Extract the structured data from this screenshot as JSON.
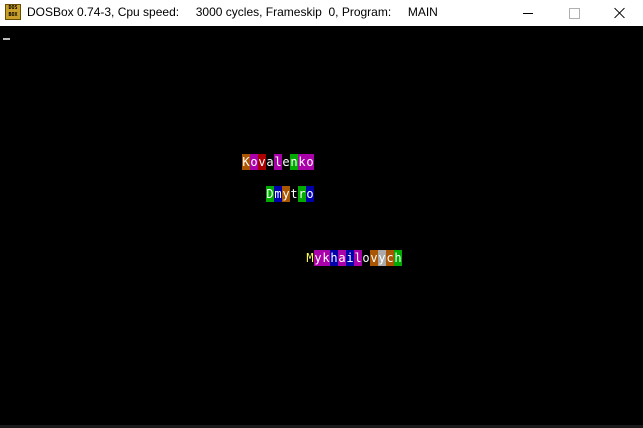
{
  "window": {
    "title": "DOSBox 0.74-3, Cpu speed:     3000 cycles, Frameskip  0, Program:     MAIN",
    "icon": "dosbox-icon",
    "icon_text": "DOS BOX"
  },
  "screen": {
    "rows": [
      {
        "name": "surname",
        "text": "Kovalenko",
        "cells": [
          {
            "ch": "K",
            "fg": "#ffffff",
            "bg": "#aa5500"
          },
          {
            "ch": "o",
            "fg": "#ffffff",
            "bg": "#aa00aa"
          },
          {
            "ch": "v",
            "fg": "#ffffff",
            "bg": "#aa0000"
          },
          {
            "ch": "a",
            "fg": "#ffffff",
            "bg": "#000000"
          },
          {
            "ch": "l",
            "fg": "#ffffff",
            "bg": "#aa00aa"
          },
          {
            "ch": "e",
            "fg": "#ffffff",
            "bg": "#000000"
          },
          {
            "ch": "n",
            "fg": "#ffffff",
            "bg": "#00aa00"
          },
          {
            "ch": "k",
            "fg": "#ffffff",
            "bg": "#aa00aa"
          },
          {
            "ch": "o",
            "fg": "#ffffff",
            "bg": "#aa00aa"
          }
        ]
      },
      {
        "name": "first-name",
        "text": "Dmytro",
        "cells": [
          {
            "ch": "D",
            "fg": "#ffffff",
            "bg": "#00aa00"
          },
          {
            "ch": "m",
            "fg": "#ffffff",
            "bg": "#0000aa"
          },
          {
            "ch": "y",
            "fg": "#ffffff",
            "bg": "#aa5500"
          },
          {
            "ch": "t",
            "fg": "#ffffff",
            "bg": "#000000"
          },
          {
            "ch": "r",
            "fg": "#ffffff",
            "bg": "#00aa00"
          },
          {
            "ch": "o",
            "fg": "#ffffff",
            "bg": "#0000aa"
          }
        ]
      },
      {
        "name": "patronymic",
        "text": "Mykhailovych",
        "cells": [
          {
            "ch": "M",
            "fg": "#ffff55",
            "bg": "#000000"
          },
          {
            "ch": "y",
            "fg": "#ffffff",
            "bg": "#aa00aa"
          },
          {
            "ch": "k",
            "fg": "#ffffff",
            "bg": "#aa00aa"
          },
          {
            "ch": "h",
            "fg": "#ffffff",
            "bg": "#0000aa"
          },
          {
            "ch": "a",
            "fg": "#ffffff",
            "bg": "#aa00aa"
          },
          {
            "ch": "i",
            "fg": "#ffffff",
            "bg": "#0000aa"
          },
          {
            "ch": "l",
            "fg": "#ffffff",
            "bg": "#aa00aa"
          },
          {
            "ch": "o",
            "fg": "#ffffff",
            "bg": "#000000"
          },
          {
            "ch": "v",
            "fg": "#ffffff",
            "bg": "#aa5500"
          },
          {
            "ch": "y",
            "fg": "#ffffff",
            "bg": "#aaaaaa"
          },
          {
            "ch": "c",
            "fg": "#ffffff",
            "bg": "#aa5500"
          },
          {
            "ch": "h",
            "fg": "#ffffff",
            "bg": "#00aa00"
          }
        ]
      }
    ]
  }
}
